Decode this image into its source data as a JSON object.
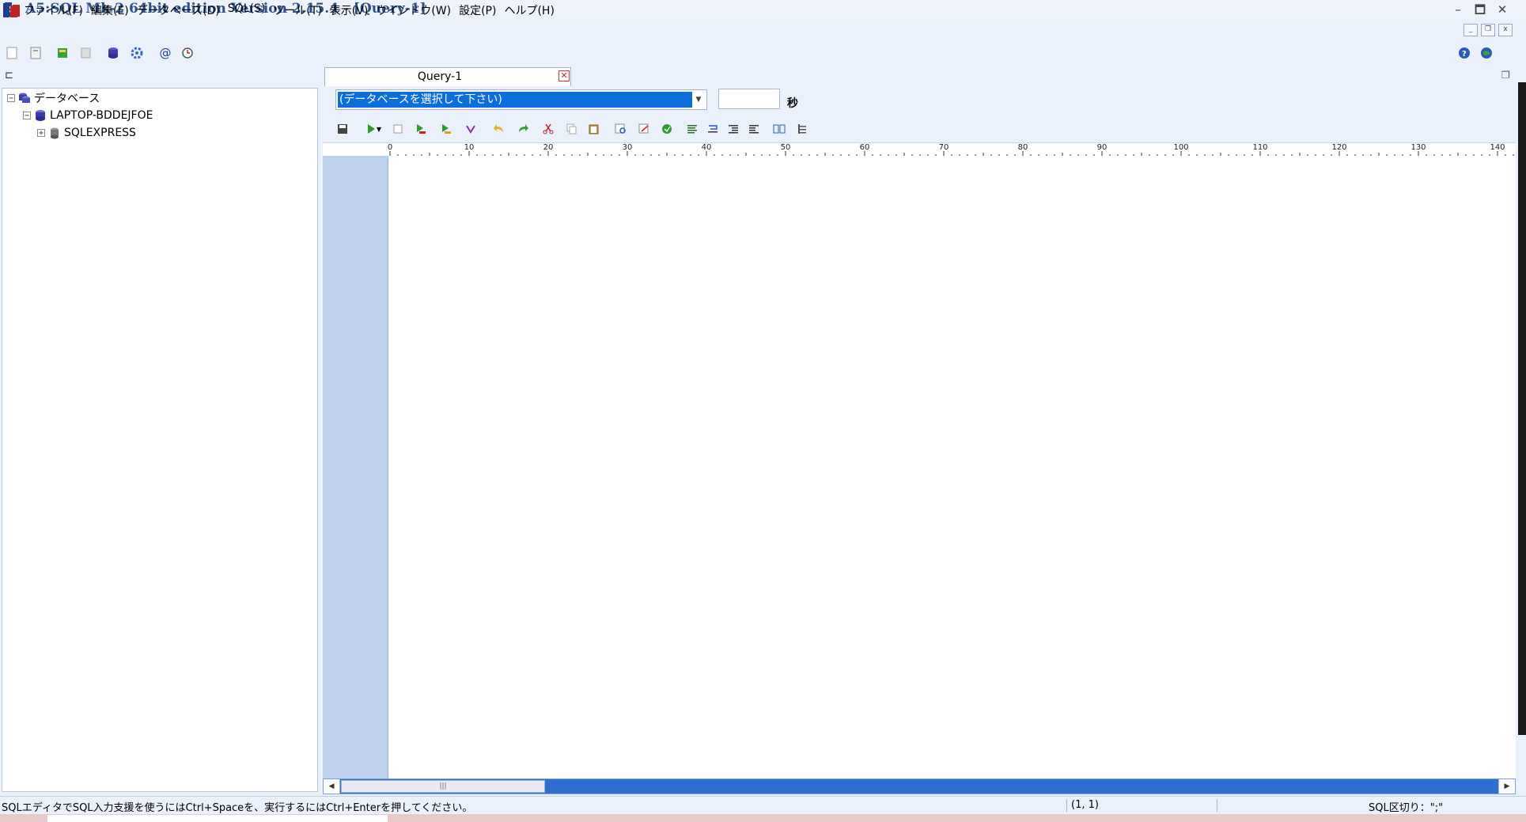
{
  "window": {
    "title": "A5:SQL Mk-2 64bit edition Version 2.15.4 - [Query-1]",
    "controls": {
      "minimize": "–",
      "maximize": "🗖",
      "close": "✕"
    }
  },
  "menu": {
    "items": [
      "ファイル(F)",
      "編集(E)",
      "データベース(D)",
      "SQL(S)",
      "ツール(T)",
      "表示(V)",
      "ウインドウ(W)",
      "設定(P)",
      "ヘルプ(H)"
    ],
    "mdi_controls": {
      "minimize": "_",
      "restore": "❐",
      "close": "x"
    }
  },
  "tree": {
    "root": {
      "label": "データベース",
      "expander": "−"
    },
    "server": {
      "label": "LAPTOP-BDDEJFOE",
      "expander": "−"
    },
    "instance": {
      "label": "SQLEXPRESS",
      "expander": "+"
    }
  },
  "tab": {
    "label": "Query-1",
    "close": "✕"
  },
  "editor": {
    "db_select_placeholder": "(データベースを選択して下さい)",
    "timeout_value": "",
    "seconds_label": "秒",
    "ruler_marks": [
      "0",
      "10",
      "20",
      "30",
      "40",
      "50",
      "60",
      "70",
      "80",
      "90",
      "100",
      "110",
      "120",
      "130",
      "140"
    ]
  },
  "scrollbar": {
    "left": "◀",
    "thumb": "|||",
    "right": "▶"
  },
  "status": {
    "message": "SQLエディタでSQL入力支援を使うにはCtrl+Spaceを、実行するにはCtrl+Enterを押してください。",
    "cursor": "(1, 1)",
    "delimiter": "SQL区切り：\";\""
  },
  "colors": {
    "accent": "#0a6fdb",
    "gutter": "#bed1ec",
    "scrollbar": "#2e6fcf"
  }
}
